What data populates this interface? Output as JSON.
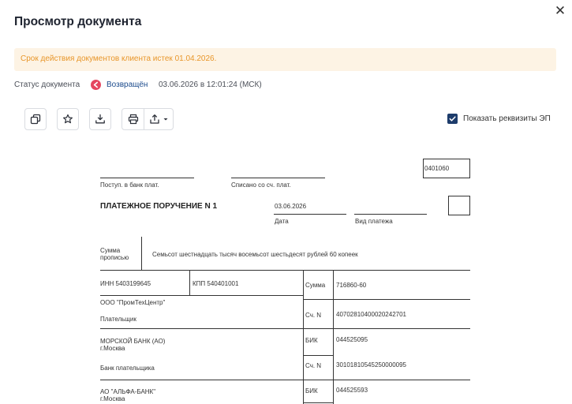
{
  "modal": {
    "title": "Просмотр документа",
    "close_glyph": "✕"
  },
  "alert": {
    "text": "Срок действия документов клиента истек 01.04.2026."
  },
  "status": {
    "label": "Статус документа",
    "value": "Возвращён",
    "datetime": "03.06.2026 в 12:01:24 (МСК)"
  },
  "toolbar": {
    "icons": [
      "copy-icon",
      "star-icon",
      "download-tray-icon",
      "print-icon",
      "share-upload-icon",
      "caret-down-icon"
    ],
    "show_signature_label": "Показать реквизиты ЭП",
    "show_signature_checked": true
  },
  "form": {
    "code": "0401060",
    "received_label": "Поступ. в банк плат.",
    "debited_label": "Списано со сч. плат.",
    "title": "ПЛАТЕЖНОЕ ПОРУЧЕНИЕ N 1",
    "date_value": "03.06.2026",
    "date_label": "Дата",
    "payment_type_label": "Вид платежа",
    "amount_words_label_1": "Сумма",
    "amount_words_label_2": "прописью",
    "amount_words": "Семьсот шестнадцать тысяч восемьсот шестьдесят рублей 60 копеек",
    "inn": "ИНН 5403199645",
    "kpp": "КПП 540401001",
    "sum_label": "Сумма",
    "sum_value": "716860-60",
    "payer_name": "ООО \"ПромТехЦентр\"",
    "payer_label": "Плательщик",
    "account_label": "Сч. N",
    "payer_account": "40702810400020242701",
    "payer_bank_name": "МОРСКОЙ БАНК (АО)",
    "payer_bank_city": "г.Москва",
    "bik_label": "БИК",
    "payer_bank_bik": "044525095",
    "payer_bank_label": "Банк плательщика",
    "payer_bank_corr_account": "30101810545250000095",
    "payee_bank_name": "АО \"АЛЬФА-БАНК\"",
    "payee_bank_city": "г.Москва",
    "payee_bank_bik": "044525593"
  }
}
